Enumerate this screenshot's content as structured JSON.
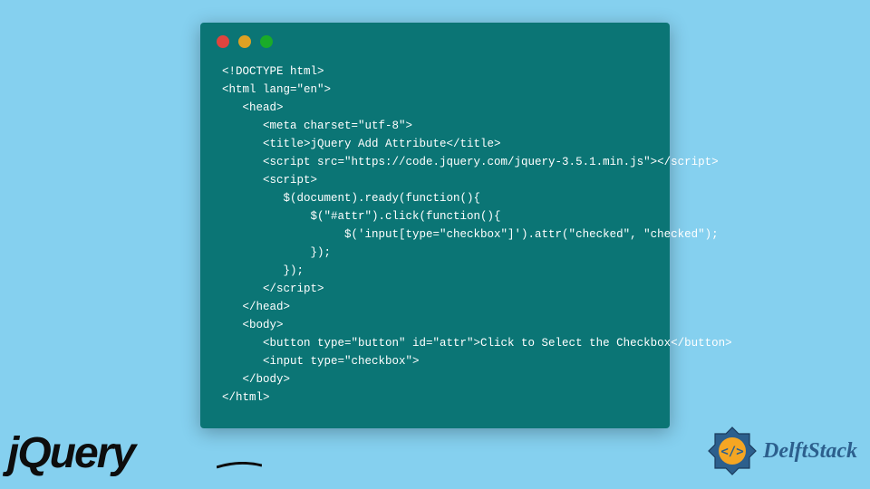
{
  "window": {
    "controls": {
      "red": "#e0443e",
      "yellow": "#dea123",
      "green": "#1aab29"
    }
  },
  "code": {
    "line1": "<!DOCTYPE html>",
    "line2": "<html lang=\"en\">",
    "line3": "   <head>",
    "line4": "      <meta charset=\"utf-8\">",
    "line5": "      <title>jQuery Add Attribute</title>",
    "line6": "      <script src=\"https://code.jquery.com/jquery-3.5.1.min.js\"></script>",
    "line7": "      <script>",
    "line8": "         $(document).ready(function(){",
    "line9": "             $(\"#attr\").click(function(){",
    "line10": "                  $('input[type=\"checkbox\"]').attr(\"checked\", \"checked\");",
    "line11": "             });",
    "line12": "         });",
    "line13": "      </script>",
    "line14": "   </head>",
    "line15": "   <body>",
    "line16": "      <button type=\"button\" id=\"attr\">Click to Select the Checkbox</button>",
    "line17": "      <input type=\"checkbox\">",
    "line18": "   </body>",
    "line19": "</html>"
  },
  "logos": {
    "jquery": "jQuery",
    "delft": "DelftStack"
  }
}
